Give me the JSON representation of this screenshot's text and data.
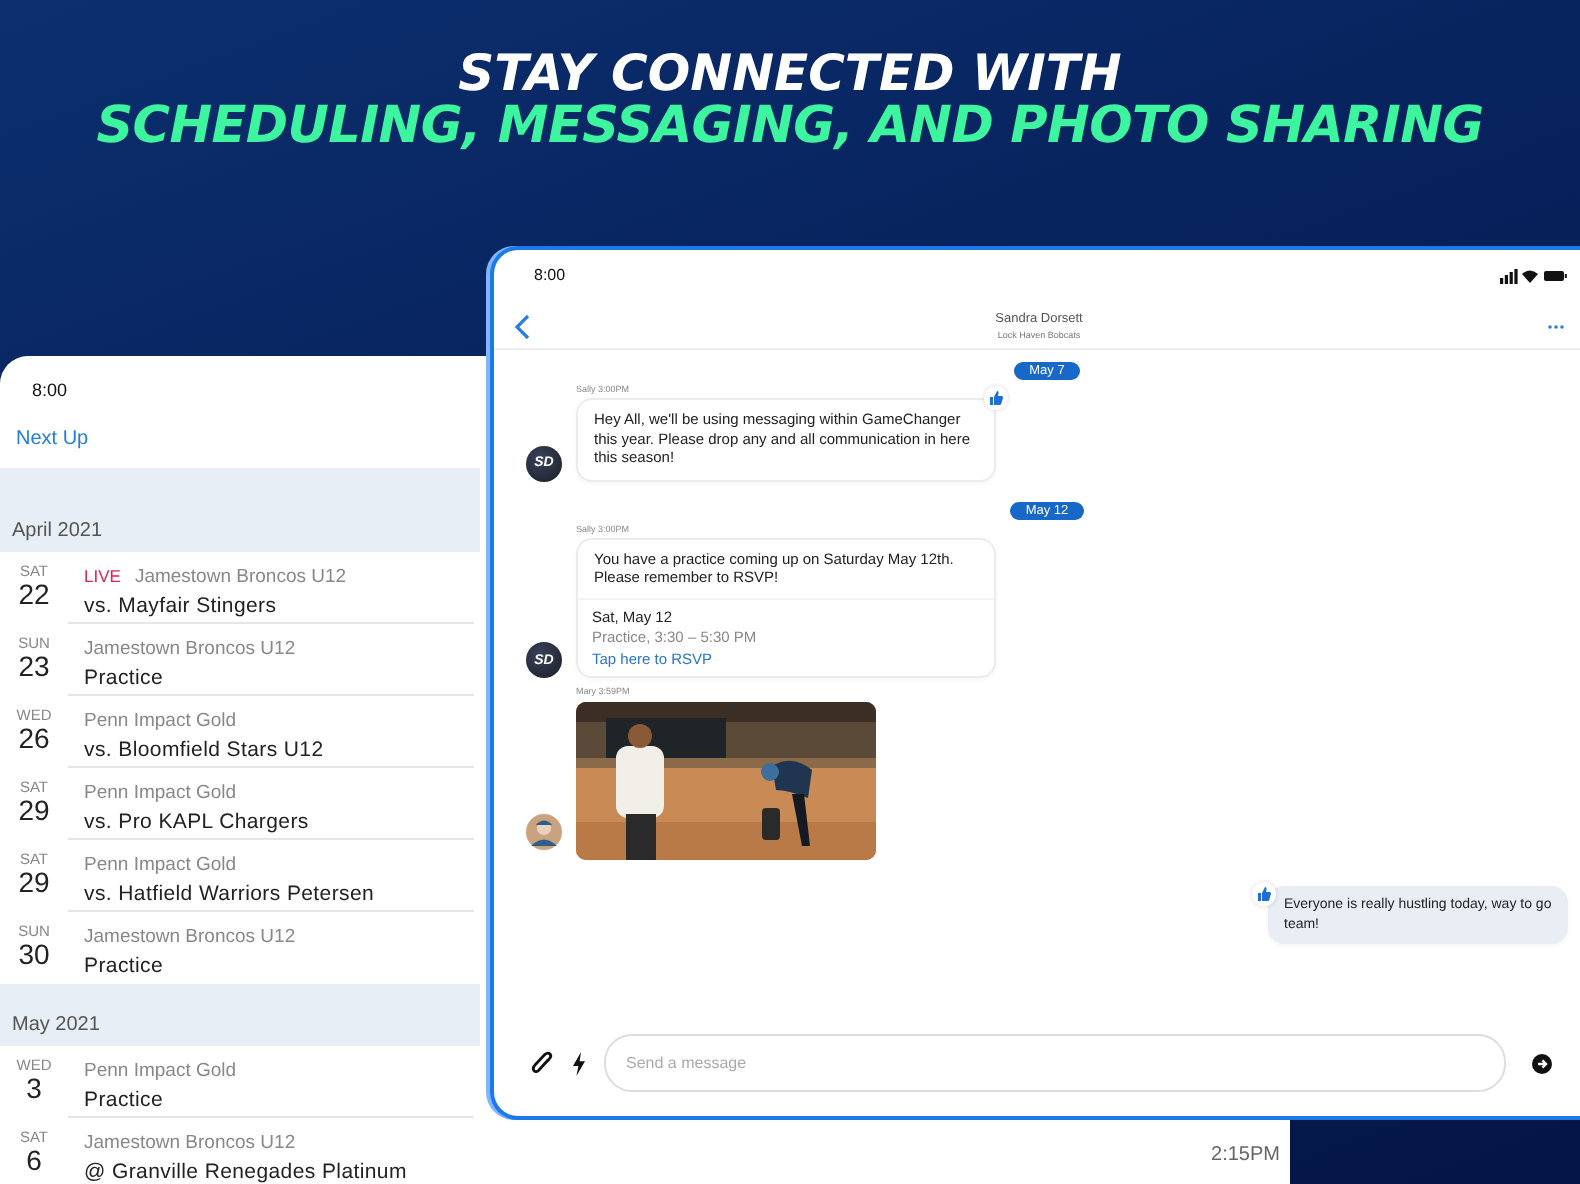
{
  "headline": {
    "line_1": "STAY CONNECTED WITH",
    "line_2": "SCHEDULING, MESSAGING, AND PHOTO SHARING"
  },
  "schedule_phone": {
    "status_time": "8:00",
    "next_up": "Next Up",
    "detail_time": "2:15PM",
    "months": [
      {
        "label": "April 2021",
        "events": [
          {
            "weekday": "SAT",
            "day": "22",
            "badge": "LIVE",
            "team": "Jamestown Broncos U12",
            "title": "vs. Mayfair Stingers"
          },
          {
            "weekday": "SUN",
            "day": "23",
            "team": "Jamestown Broncos U12",
            "title": "Practice"
          },
          {
            "weekday": "WED",
            "day": "26",
            "team": "Penn Impact Gold",
            "title": "vs. Bloomfield Stars U12"
          },
          {
            "weekday": "SAT",
            "day": "29",
            "team": "Penn Impact Gold",
            "title": "vs. Pro KAPL Chargers"
          },
          {
            "weekday": "SAT",
            "day": "29",
            "team": "Penn Impact Gold",
            "title": "vs. Hatfield Warriors Petersen"
          },
          {
            "weekday": "SUN",
            "day": "30",
            "team": "Jamestown Broncos U12",
            "title": "Practice"
          }
        ]
      },
      {
        "label": "May 2021",
        "events": [
          {
            "weekday": "WED",
            "day": "3",
            "team": "Penn Impact Gold",
            "title": "Practice"
          },
          {
            "weekday": "SAT",
            "day": "6",
            "team": "Jamestown Broncos U12",
            "title": "@ Granville Renegades Platinum"
          }
        ]
      }
    ]
  },
  "chat_tablet": {
    "status_time": "8:00",
    "contact": {
      "name": "Sandra Dorsett",
      "team": "Lock Haven Bobcats"
    },
    "messages": [
      {
        "kind": "date",
        "label": "May 7"
      },
      {
        "kind": "text",
        "mine": false,
        "sender": "Sally 3:00PM",
        "avatar": {
          "kind": "initials",
          "text": "SD"
        },
        "text": "Hey All, we'll be using messaging within GameChanger this year. Please drop any and all communication in here this season!",
        "liked": true
      },
      {
        "kind": "date",
        "label": "May 12"
      },
      {
        "kind": "event",
        "mine": false,
        "sender": "Sally 3:00PM",
        "avatar": {
          "kind": "initials",
          "text": "SD"
        },
        "text": "You have a practice coming up on Saturday May 12th. Please remember to RSVP!",
        "event_date": "Sat, May 12",
        "event_detail": "Practice, 3:30 – 5:30 PM",
        "link": "Tap here to RSVP"
      },
      {
        "mine": false,
        "sender": "Mary 3:59PM"
      },
      {
        "kind": "text",
        "mine": true,
        "text": "Everyone is really hustling today, way to go team!",
        "liked": true
      }
    ],
    "composer": {
      "placeholder": "Send a message"
    }
  }
}
